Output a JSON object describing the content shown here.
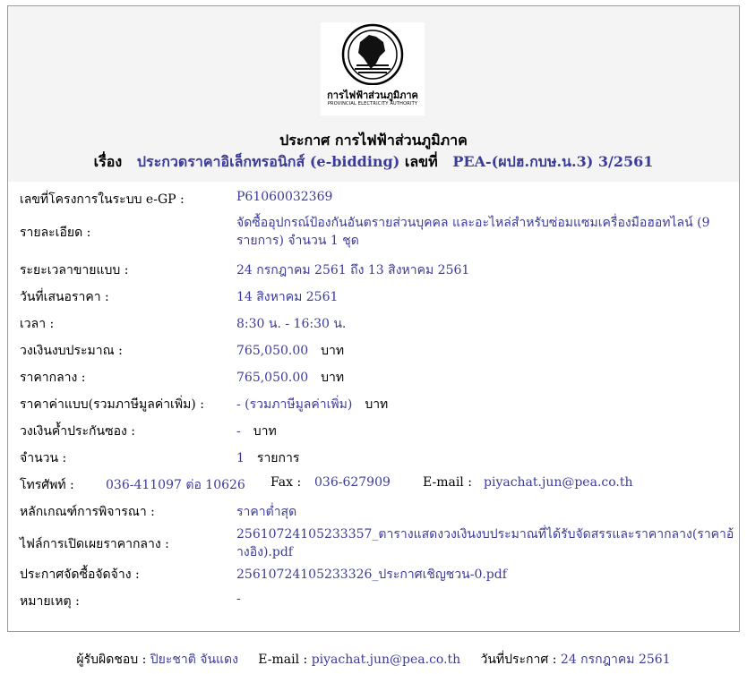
{
  "header": {
    "logo_th": "การไฟฟ้าส่วนภูมิภาค",
    "logo_en": "PROVINCIAL ELECTRICITY AUTHORITY",
    "title": "ประกาศ การไฟฟ้าส่วนภูมิภาค",
    "subject_label": "เรื่อง",
    "subject_value": "ประกวดราคาอิเล็กทรอนิกส์ (e-bidding)",
    "number_label": "เลขที่",
    "number_value": "PEA-(ผปฮ.กบษ.น.3) 3/2561"
  },
  "details": {
    "project_no": {
      "label": "เลขที่โครงการในระบบ e-GP :",
      "value": "P61060032369"
    },
    "description": {
      "label": "รายละเอียด :",
      "value": "จัดซื้ออุปกรณ์ป้องกันอันตรายส่วนบุคคล และอะไหล่สำหรับซ่อมแซมเครื่องมือฮอทไลน์ (9 รายการ) จำนวน 1 ชุด"
    },
    "sale_period": {
      "label": "ระยะเวลาขายแบบ :",
      "value": "24 กรกฎาคม 2561 ถึง 13 สิงหาคม 2561"
    },
    "bid_date": {
      "label": "วันที่เสนอราคา :",
      "value": "14 สิงหาคม 2561"
    },
    "time": {
      "label": "เวลา :",
      "value": "8:30 น. - 16:30 น."
    },
    "budget": {
      "label": "วงเงินงบประมาณ :",
      "value": "765,050.00",
      "unit": "บาท"
    },
    "median_price": {
      "label": "ราคากลาง :",
      "value": "765,050.00",
      "unit": "บาท"
    },
    "doc_price": {
      "label": "ราคาค่าแบบ(รวมภาษีมูลค่าเพิ่ม) :",
      "value": "- (รวมภาษีมูลค่าเพิ่ม)",
      "unit": "บาท"
    },
    "guarantee": {
      "label": "วงเงินค้ำประกันซอง :",
      "value": "-",
      "unit": "บาท"
    },
    "quantity": {
      "label": "จำนวน :",
      "value": "1",
      "unit": "รายการ"
    },
    "contact": {
      "phone_label": "โทรศัพท์ :",
      "phone": "036-411097 ต่อ 10626",
      "fax_label": "Fax :",
      "fax": "036-627909",
      "email_label": "E-mail :",
      "email": "piyachat.jun@pea.co.th"
    },
    "criteria": {
      "label": "หลักเกณฑ์การพิจารณา :",
      "value": "ราคาต่ำสุด"
    },
    "median_file": {
      "label": "ไฟล์การเปิดเผยราคากลาง :",
      "value": "25610724105233357_ตารางแสดงวงเงินงบประมาณที่ได้รับจัดสรรและราคากลาง(ราคาอ้างอิง).pdf"
    },
    "announce_file": {
      "label": "ประกาศจัดซื้อจัดจ้าง :",
      "value": "25610724105233326_ประกาศเชิญชวน-0.pdf"
    },
    "remark": {
      "label": "หมายเหตุ :",
      "value": "-"
    }
  },
  "footer": {
    "responsible_label": "ผู้รับผิดชอบ :",
    "responsible": "ปิยะชาติ จันแดง",
    "email_label": "E-mail :",
    "email": "piyachat.jun@pea.co.th",
    "date_label": "วันที่ประกาศ :",
    "date": "24 กรกฎาคม 2561"
  }
}
